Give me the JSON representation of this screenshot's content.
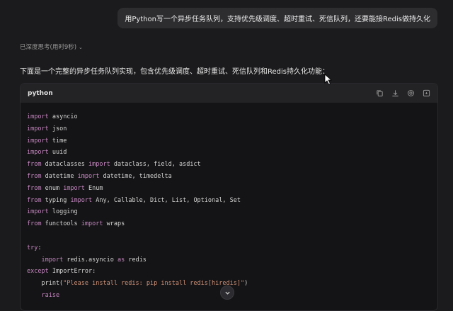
{
  "user_message": "用Python写一个异步任务队列，支持优先级调度、超时重试、死信队列，还要能接Redis做持久化",
  "thinking": {
    "label": "已深度思考(用时9秒)",
    "chevron_icon": "chevron-down-icon"
  },
  "intro_text": "下面是一个完整的异步任务队列实现，包含优先级调度、超时重试、死信队列和Redis持久化功能：",
  "code_block": {
    "language": "python",
    "tools": [
      "copy-icon",
      "download-icon",
      "settings-icon",
      "expand-icon"
    ],
    "lines": [
      [
        {
          "t": "import",
          "k": "kw"
        },
        {
          "t": " asyncio"
        }
      ],
      [
        {
          "t": "import",
          "k": "kw"
        },
        {
          "t": " json"
        }
      ],
      [
        {
          "t": "import",
          "k": "kw"
        },
        {
          "t": " time"
        }
      ],
      [
        {
          "t": "import",
          "k": "kw"
        },
        {
          "t": " uuid"
        }
      ],
      [
        {
          "t": "from",
          "k": "kw"
        },
        {
          "t": " dataclasses "
        },
        {
          "t": "import",
          "k": "kw"
        },
        {
          "t": " dataclass, field, asdict"
        }
      ],
      [
        {
          "t": "from",
          "k": "kw"
        },
        {
          "t": " datetime "
        },
        {
          "t": "import",
          "k": "kw"
        },
        {
          "t": " datetime, timedelta"
        }
      ],
      [
        {
          "t": "from",
          "k": "kw"
        },
        {
          "t": " enum "
        },
        {
          "t": "import",
          "k": "kw"
        },
        {
          "t": " Enum"
        }
      ],
      [
        {
          "t": "from",
          "k": "kw"
        },
        {
          "t": " typing "
        },
        {
          "t": "import",
          "k": "kw"
        },
        {
          "t": " Any, Callable, Dict, List, Optional, Set"
        }
      ],
      [
        {
          "t": "import",
          "k": "kw"
        },
        {
          "t": " logging"
        }
      ],
      [
        {
          "t": "from",
          "k": "kw"
        },
        {
          "t": " functools "
        },
        {
          "t": "import",
          "k": "kw"
        },
        {
          "t": " wraps"
        }
      ],
      [],
      [
        {
          "t": "try",
          "k": "kw"
        },
        {
          "t": ":"
        }
      ],
      [
        {
          "t": "    "
        },
        {
          "t": "import",
          "k": "kw"
        },
        {
          "t": " redis.asyncio "
        },
        {
          "t": "as",
          "k": "kw"
        },
        {
          "t": " redis"
        }
      ],
      [
        {
          "t": "except",
          "k": "kw"
        },
        {
          "t": " ImportError:"
        }
      ],
      [
        {
          "t": "    print("
        },
        {
          "t": "\"Please install redis: pip install redis[hiredis]\"",
          "k": "str"
        },
        {
          "t": ")"
        }
      ],
      [
        {
          "t": "    "
        },
        {
          "t": "raise",
          "k": "kw"
        }
      ]
    ]
  },
  "scroll_button_icon": "arrow-down-icon"
}
